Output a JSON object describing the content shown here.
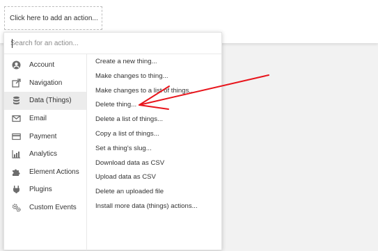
{
  "workflow": {
    "add_action_label": "Click here to add an action..."
  },
  "search": {
    "placeholder": "Search for an action..."
  },
  "categories": [
    {
      "label": "Account",
      "icon": "account-icon"
    },
    {
      "label": "Navigation",
      "icon": "navigation-icon"
    },
    {
      "label": "Data (Things)",
      "icon": "database-icon",
      "selected": true
    },
    {
      "label": "Email",
      "icon": "email-icon"
    },
    {
      "label": "Payment",
      "icon": "payment-icon"
    },
    {
      "label": "Analytics",
      "icon": "analytics-icon"
    },
    {
      "label": "Element Actions",
      "icon": "puzzle-icon"
    },
    {
      "label": "Plugins",
      "icon": "plug-icon"
    },
    {
      "label": "Custom Events",
      "icon": "gears-icon"
    }
  ],
  "actions": [
    "Create a new thing...",
    "Make changes to thing...",
    "Make changes to a list of things...",
    "Delete thing...",
    "Delete a list of things...",
    "Copy a list of things...",
    "Set a thing's slug...",
    "Download data as CSV",
    "Upload data as CSV",
    "Delete an uploaded file",
    "Install more data (things) actions..."
  ],
  "colors": {
    "annotation_arrow": "#e8141b",
    "selected_category_bg": "#ececec",
    "icon_gray": "#6d6d6d"
  }
}
